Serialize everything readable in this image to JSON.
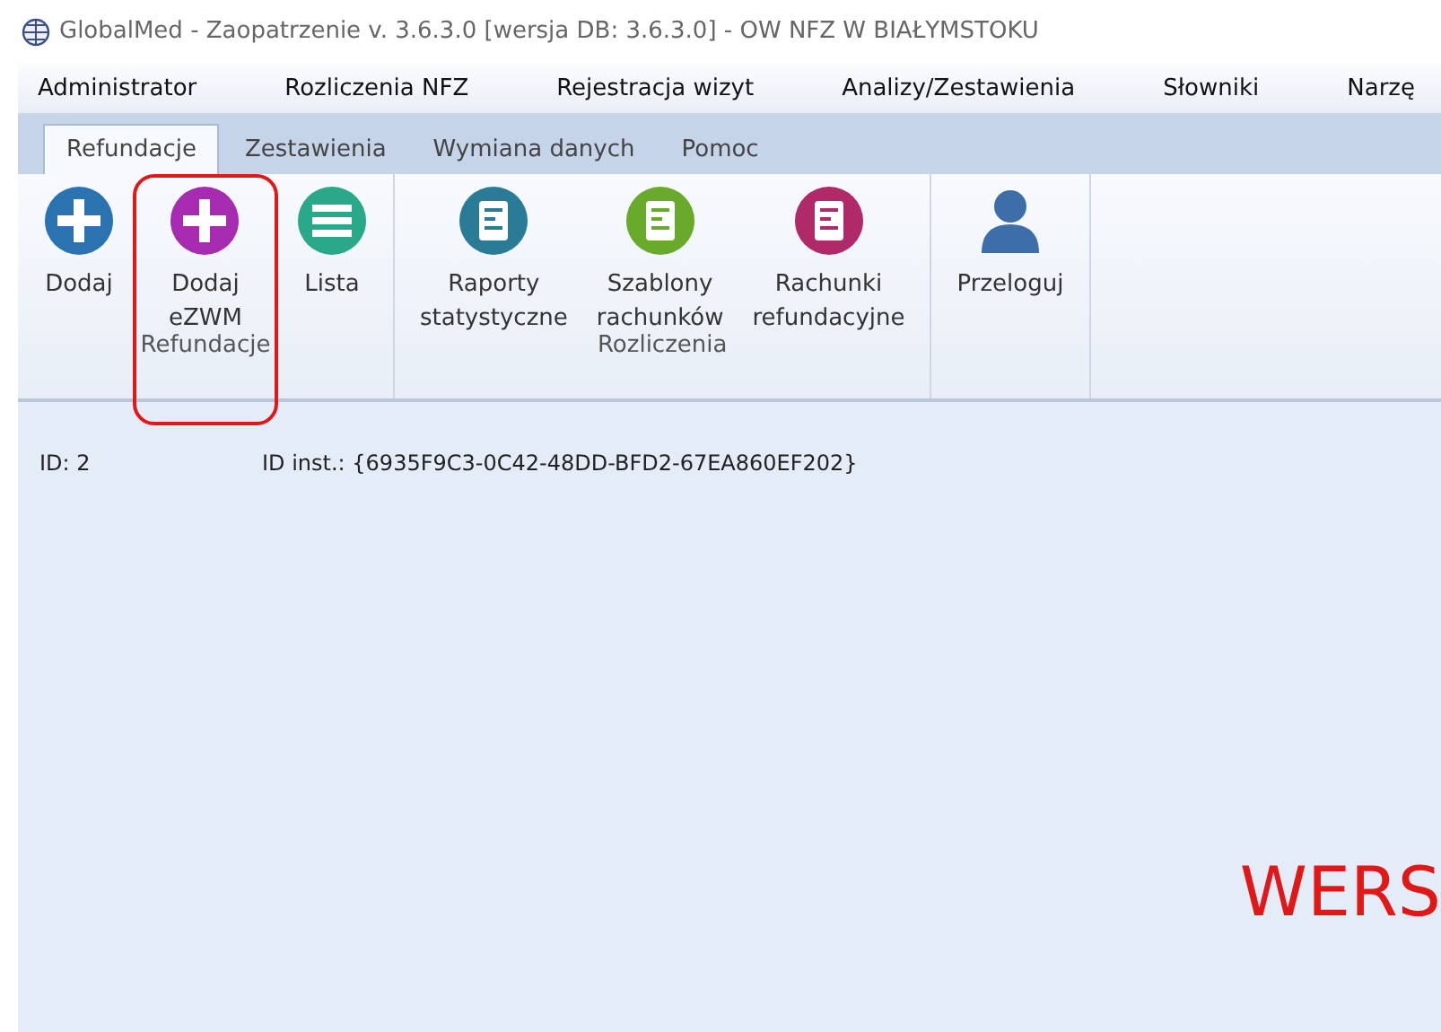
{
  "window": {
    "title": "GlobalMed - Zaopatrzenie v. 3.6.3.0 [wersja DB: 3.6.3.0] - OW NFZ W BIAŁYMSTOKU"
  },
  "menu": [
    "Administrator",
    "Rozliczenia NFZ",
    "Rejestracja wizyt",
    "Analizy/Zestawienia",
    "Słowniki",
    "Narzę"
  ],
  "tabs": [
    {
      "label": "Refundacje",
      "selected": true
    },
    {
      "label": "Zestawienia",
      "selected": false
    },
    {
      "label": "Wymiana danych",
      "selected": false
    },
    {
      "label": "Pomoc",
      "selected": false
    }
  ],
  "ribbon": [
    {
      "label": "Refundacje",
      "buttons": [
        {
          "label": "Dodaj",
          "kind": "plus",
          "color": "#2a73b0",
          "highlighted": false
        },
        {
          "label": "Dodaj\neZWM",
          "kind": "plus",
          "color": "#a62bb0",
          "highlighted": true
        },
        {
          "label": "Lista",
          "kind": "list",
          "color": "#2aa88a",
          "highlighted": false
        }
      ]
    },
    {
      "label": "Rozliczenia",
      "buttons": [
        {
          "label": "Raporty\nstatystyczne",
          "kind": "document",
          "color": "#2a7c96",
          "highlighted": false
        },
        {
          "label": "Szablony\nrachunków",
          "kind": "document",
          "color": "#6aaa2a",
          "highlighted": false
        },
        {
          "label": "Rachunki\nrefundacyjne",
          "kind": "document",
          "color": "#b02a6a",
          "highlighted": false
        }
      ]
    },
    {
      "buttons": [
        {
          "label": "Przeloguj",
          "kind": "user",
          "color": "#3d6ea8",
          "highlighted": false
        }
      ]
    }
  ],
  "content": {
    "id": "ID: 2",
    "instance_id": "ID inst.: {6935F9C3-0C42-48DD-BFD2-67EA860EF202}",
    "watermark_text": "WERS"
  }
}
